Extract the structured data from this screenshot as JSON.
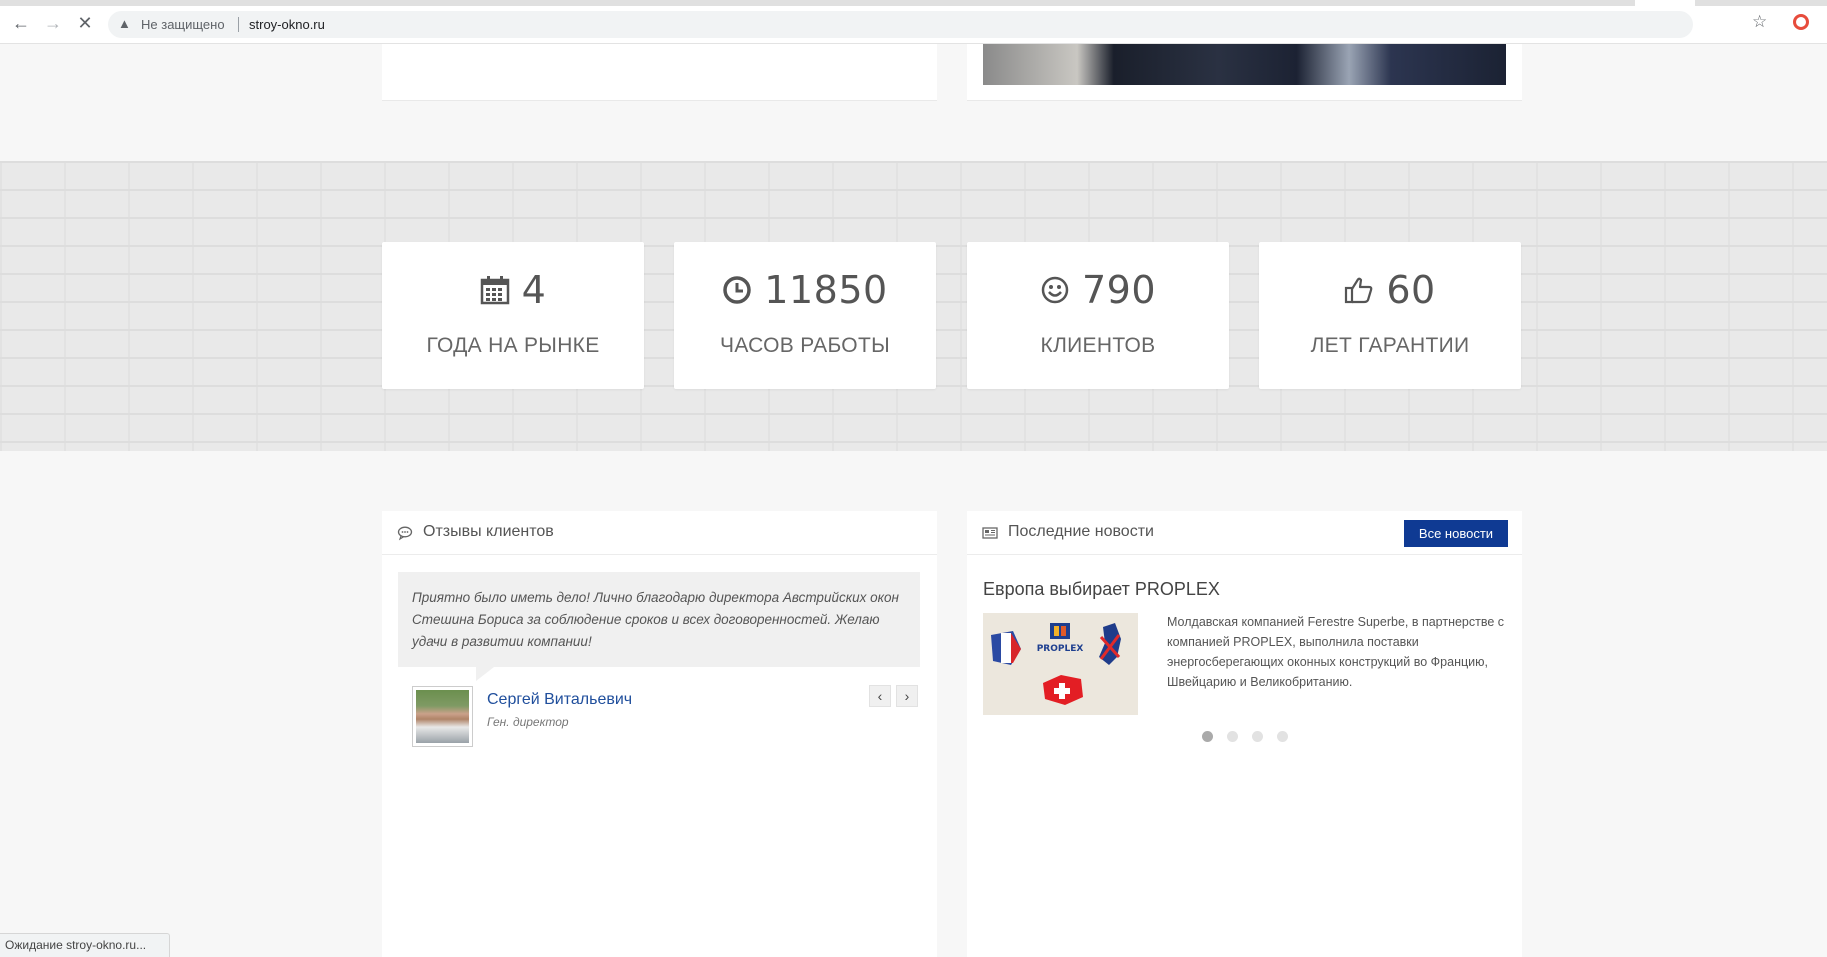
{
  "browser": {
    "security_label": "Не защищено",
    "url": "stroy-okno.ru",
    "status_text": "Ожидание stroy-okno.ru..."
  },
  "stats": [
    {
      "icon": "calendar-icon",
      "value": "4",
      "label": "ГОДА НА РЫНКЕ"
    },
    {
      "icon": "clock-icon",
      "value": "11850",
      "label": "ЧАСОВ РАБОТЫ"
    },
    {
      "icon": "smiley-icon",
      "value": "790",
      "label": "КЛИЕНТОВ"
    },
    {
      "icon": "thumbs-up-icon",
      "value": "60",
      "label": "ЛЕТ ГАРАНТИИ"
    }
  ],
  "reviews": {
    "title": "Отзывы клиентов",
    "quote": "Приятно было иметь дело! Лично благодарю директора Австрийских окон Стешина Бориса за соблюдение сроков и всех договоренностей. Желаю удачи в развитии компании!",
    "author": "Сергей Витальевич",
    "role": "Ген. директор",
    "prev": "‹",
    "next": "›"
  },
  "news": {
    "title": "Последние новости",
    "all_button": "Все новости",
    "item_title": "Европа выбирает PROPLEX",
    "item_text": "Молдавская компанией Ferestre Superbe, в партнерстве с компанией PROPLEX, выполнила поставки энергосберегающих оконных конструкций во Францию, Швейцарию и Великобританию.",
    "logo_text": "PROPLEX",
    "slides_total": 4,
    "slide_active": 1
  },
  "colors": {
    "accent": "#0f3a93",
    "link": "#1f4e9c"
  }
}
